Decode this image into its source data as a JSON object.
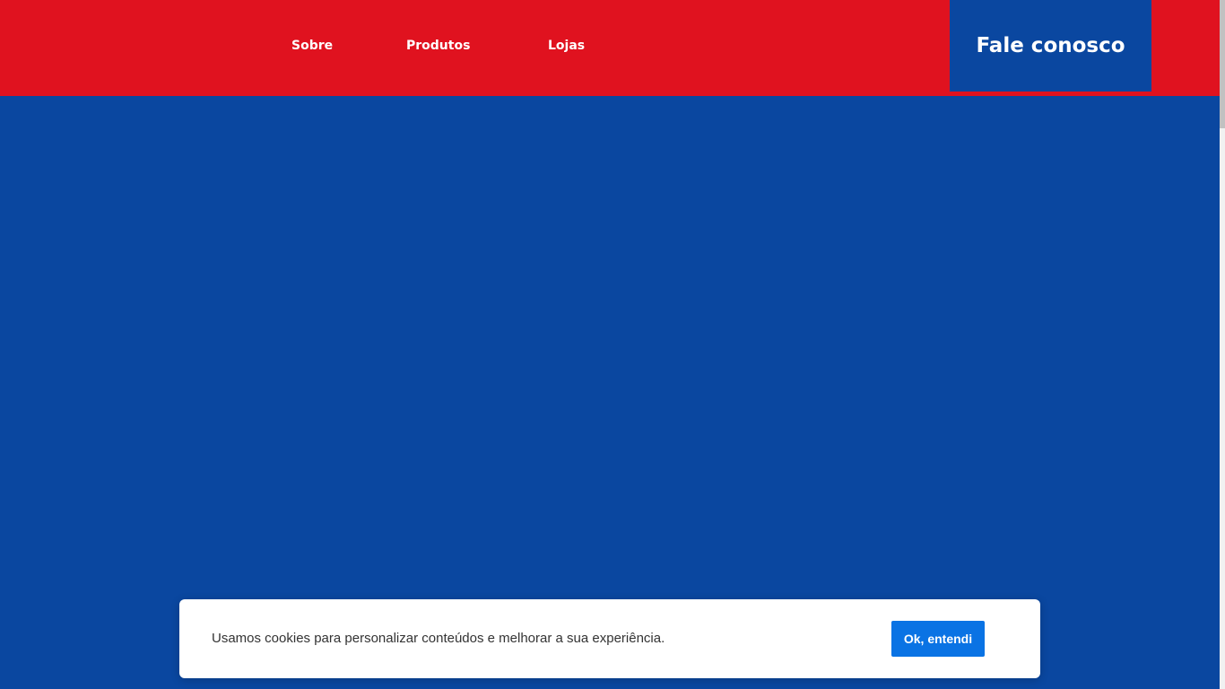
{
  "header": {
    "background_color": "#e0121f",
    "nav": [
      {
        "label": "Sobre"
      },
      {
        "label": "Produtos"
      },
      {
        "label": "Lojas"
      }
    ],
    "cta": {
      "label": "Fale conosco",
      "background_color": "#0a47a0"
    }
  },
  "hero": {
    "background_color": "#0a47a0"
  },
  "cookie_banner": {
    "message": "Usamos cookies para personalizar conteúdos e melhorar a sua experiência.",
    "button_label": "Ok, entendi",
    "button_color": "#0a73e4"
  }
}
